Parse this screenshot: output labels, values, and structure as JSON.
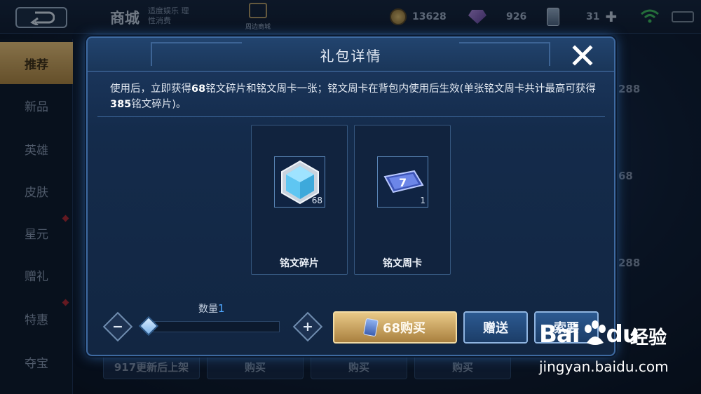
{
  "topbar": {
    "store_title": "商城",
    "slogan": "适度娱乐 理性消费",
    "nearby_label": "周边商城",
    "coins": "13628",
    "gems": "926",
    "cards": "31"
  },
  "sidebar": {
    "items": [
      {
        "label": "推荐"
      },
      {
        "label": "新品"
      },
      {
        "label": "英雄"
      },
      {
        "label": "皮肤"
      },
      {
        "label": "星元"
      },
      {
        "label": "赠礼"
      },
      {
        "label": "特惠"
      },
      {
        "label": "夺宝"
      }
    ]
  },
  "background": {
    "prices": [
      "288",
      "68",
      "288"
    ],
    "notice": "917更新后上架",
    "buy_labels": [
      "购买",
      "购买",
      "购买"
    ]
  },
  "modal": {
    "title": "礼包详情",
    "description_a": "使用后，立即获得",
    "description_b": "68",
    "description_c": "铭文碎片和铭文周卡一张；铭文周卡在背包内使用后生效(单张铭文周卡共计最高可获得",
    "description_d": "385",
    "description_e": "铭文碎片)。",
    "items": [
      {
        "name": "铭文碎片",
        "count": "68",
        "icon": "inscription-shard-icon"
      },
      {
        "name": "铭文周卡",
        "count": "1",
        "icon": "inscription-weekly-card-icon"
      }
    ],
    "quantity_label": "数量",
    "quantity_value": "1",
    "quantity_slider_fraction": 0.0,
    "buy_label": "68购买",
    "gift_label": "赠送",
    "request_label": "索要"
  },
  "watermark": {
    "brand_b": "Bai",
    "brand_du": "du",
    "brand_jy": "经验",
    "url": "jingyan.baidu.com"
  },
  "colors": {
    "accent_gold": "#e9c987",
    "panel_blue": "#1d3a62",
    "quantity_blue": "#4fa8ff"
  }
}
